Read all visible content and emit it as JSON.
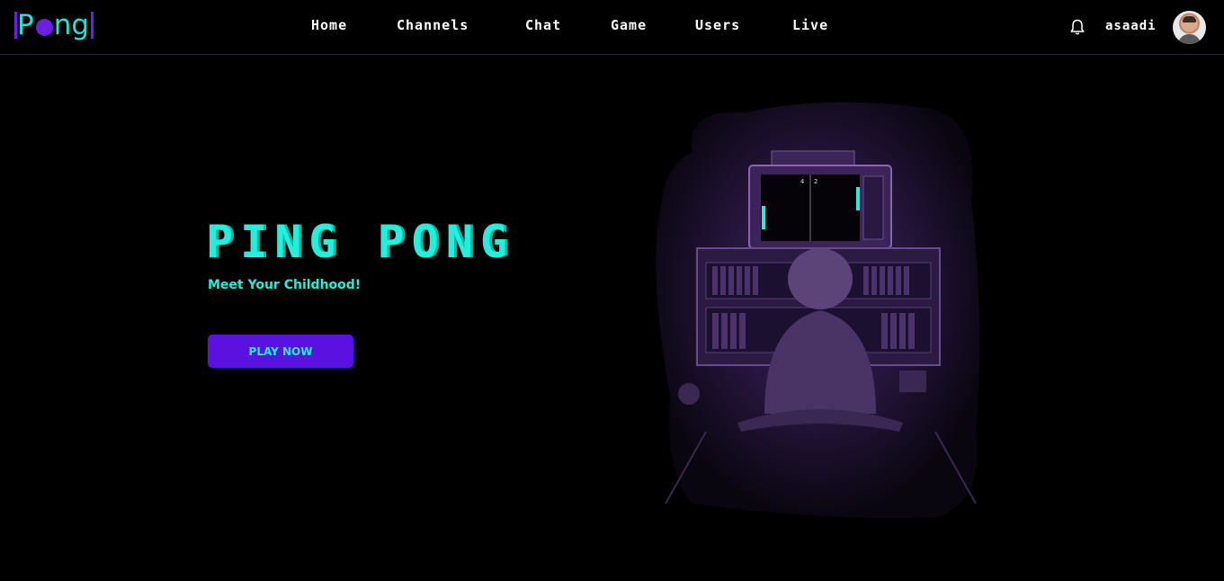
{
  "header": {
    "logo_text": "Pong",
    "nav": [
      {
        "label": "Home",
        "name": "nav-home"
      },
      {
        "label": "Channels",
        "name": "nav-channels"
      },
      {
        "label": "Chat",
        "name": "nav-chat"
      },
      {
        "label": "Game",
        "name": "nav-game"
      },
      {
        "label": "Users",
        "name": "nav-users"
      },
      {
        "label": "Live",
        "name": "nav-live"
      }
    ],
    "username": "asaadi",
    "icons": {
      "notifications": "bell-icon"
    }
  },
  "hero": {
    "title": "PING PONG",
    "subtitle": "Meet Your Childhood!",
    "cta_label": "PLAY NOW",
    "score_left": "4",
    "score_right": "2"
  },
  "colors": {
    "background": "#000000",
    "accent_cyan": "#22f0dc",
    "accent_purple": "#5b12e0"
  }
}
